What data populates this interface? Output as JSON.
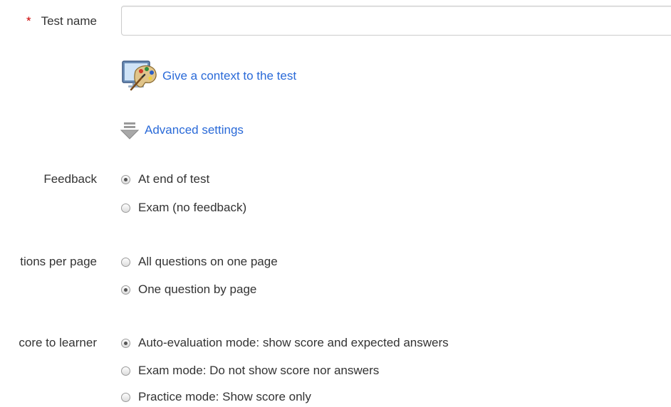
{
  "form": {
    "test_name": {
      "required_marker": "*",
      "label": "Test name",
      "value": "",
      "placeholder": ""
    },
    "context_link": {
      "icon": "palette-monitor-icon",
      "label": "Give a context to the test"
    },
    "advanced_link": {
      "icon": "arrow-down-icon",
      "label": "Advanced settings"
    },
    "feedback": {
      "label": "Feedback",
      "options": [
        {
          "label": "At end of test",
          "checked": true
        },
        {
          "label": "Exam (no feedback)",
          "checked": false
        }
      ]
    },
    "questions_per_page": {
      "label": "tions per page",
      "options": [
        {
          "label": "All questions on one page",
          "checked": false
        },
        {
          "label": "One question by page",
          "checked": true
        }
      ]
    },
    "score_to_learner": {
      "label": "core to learner",
      "options": [
        {
          "label": "Auto-evaluation mode: show score and expected answers",
          "checked": true
        },
        {
          "label": "Exam mode: Do not show score nor answers",
          "checked": false
        },
        {
          "label": "Practice mode: Show score only",
          "checked": false
        }
      ]
    }
  },
  "colors": {
    "link": "#2a6ad8",
    "required": "#cc0000",
    "text": "#333333",
    "input_border": "#cccccc"
  }
}
